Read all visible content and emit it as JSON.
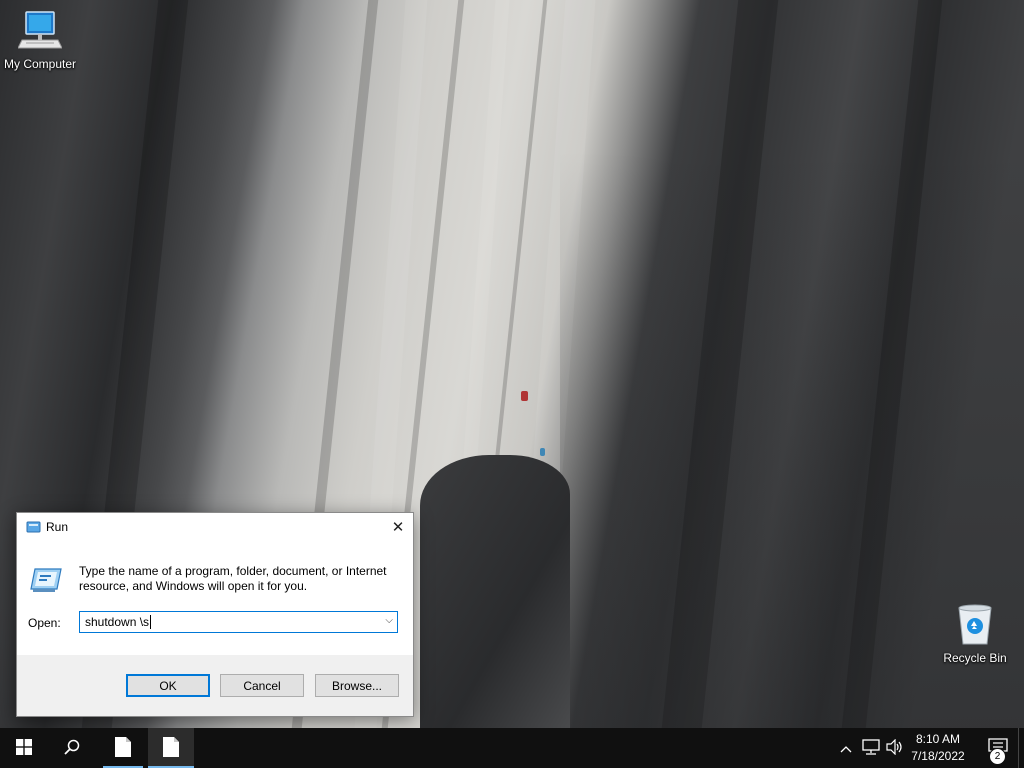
{
  "desktop": {
    "icons": [
      {
        "label": "My Computer",
        "icon": "monitor-icon"
      },
      {
        "label": "Recycle Bin",
        "icon": "recycle-bin-icon"
      }
    ]
  },
  "run_dialog": {
    "title": "Run",
    "description": "Type the name of a program, folder, document, or Internet resource, and Windows will open it for you.",
    "open_label": "Open:",
    "open_value": "shutdown \\s",
    "buttons": {
      "ok": "OK",
      "cancel": "Cancel",
      "browse": "Browse..."
    }
  },
  "taskbar": {
    "items": [
      "windows-start-icon",
      "search-icon",
      "document-icon",
      "document-icon"
    ],
    "tray": {
      "time": "8:10 AM",
      "date": "7/18/2022",
      "notification_count": "2"
    }
  },
  "colors": {
    "taskbar": "#101010",
    "accent": "#0078d7",
    "dialog_footer": "#f0f0f0"
  }
}
